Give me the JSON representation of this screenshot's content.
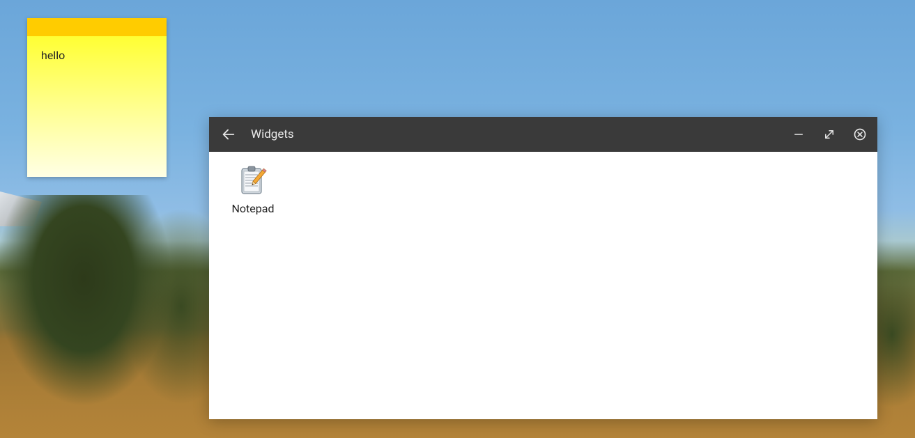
{
  "sticky_note": {
    "content": "hello"
  },
  "widgets_window": {
    "title": "Widgets",
    "items": [
      {
        "label": "Notepad"
      }
    ]
  }
}
